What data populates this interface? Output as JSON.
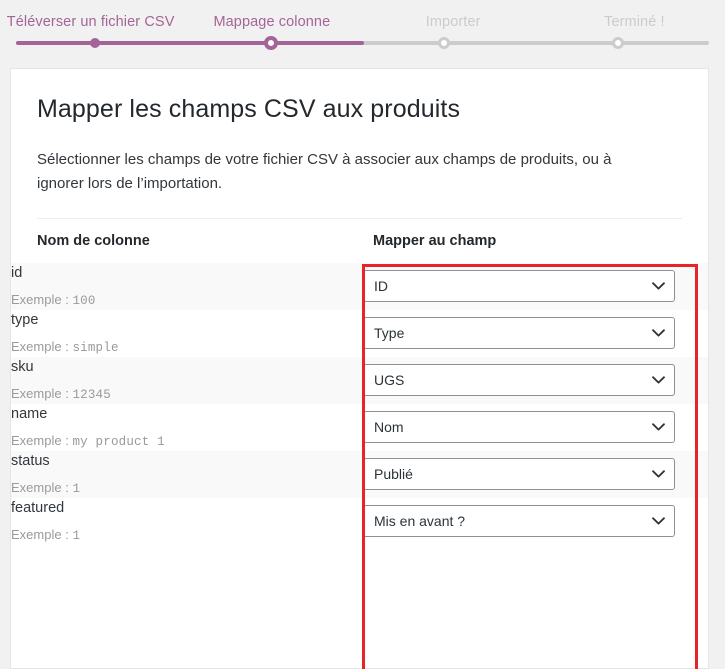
{
  "stepper": {
    "steps": [
      {
        "label": "Téléverser un fichier CSV",
        "state": "done"
      },
      {
        "label": "Mappage colonne",
        "state": "current"
      },
      {
        "label": "Importer",
        "state": "todo"
      },
      {
        "label": "Terminé !",
        "state": "todo"
      }
    ],
    "accent_color": "#a46497",
    "inactive_color": "#cccccc"
  },
  "card": {
    "title": "Mapper les champs CSV aux produits",
    "description": "Sélectionner les champs de votre fichier CSV à associer aux champs de produits, ou à ignorer lors de l’importation."
  },
  "table": {
    "headers": {
      "column_name": "Nom de colonne",
      "map_to_field": "Mapper au champ"
    },
    "example_prefix": "Exemple :",
    "rows": [
      {
        "name": "id",
        "example": "100",
        "selected": "ID"
      },
      {
        "name": "type",
        "example": "simple",
        "selected": "Type"
      },
      {
        "name": "sku",
        "example": "12345",
        "selected": "UGS"
      },
      {
        "name": "name",
        "example": "my product 1",
        "selected": "Nom"
      },
      {
        "name": "status",
        "example": "1",
        "selected": "Publié"
      },
      {
        "name": "featured",
        "example": "1",
        "selected": "Mis en avant ?"
      }
    ]
  },
  "annotation": {
    "color": "#e8232a"
  }
}
